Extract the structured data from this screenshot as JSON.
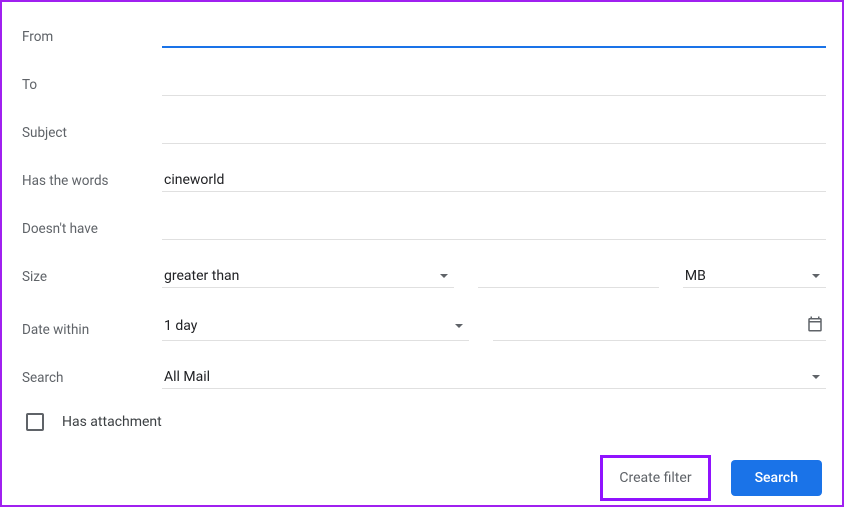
{
  "labels": {
    "from": "From",
    "to": "To",
    "subject": "Subject",
    "has_words": "Has the words",
    "doesnt_have": "Doesn't have",
    "size": "Size",
    "date_within": "Date within",
    "search": "Search",
    "has_attachment": "Has attachment"
  },
  "fields": {
    "from": "",
    "to": "",
    "subject": "",
    "has_words": "cineworld",
    "doesnt_have": "",
    "size_operator": "greater than",
    "size_value": "",
    "size_unit": "MB",
    "date_within": "1 day",
    "date_range": "",
    "search_in": "All Mail",
    "has_attachment_checked": false
  },
  "buttons": {
    "create_filter": "Create filter",
    "search": "Search"
  }
}
